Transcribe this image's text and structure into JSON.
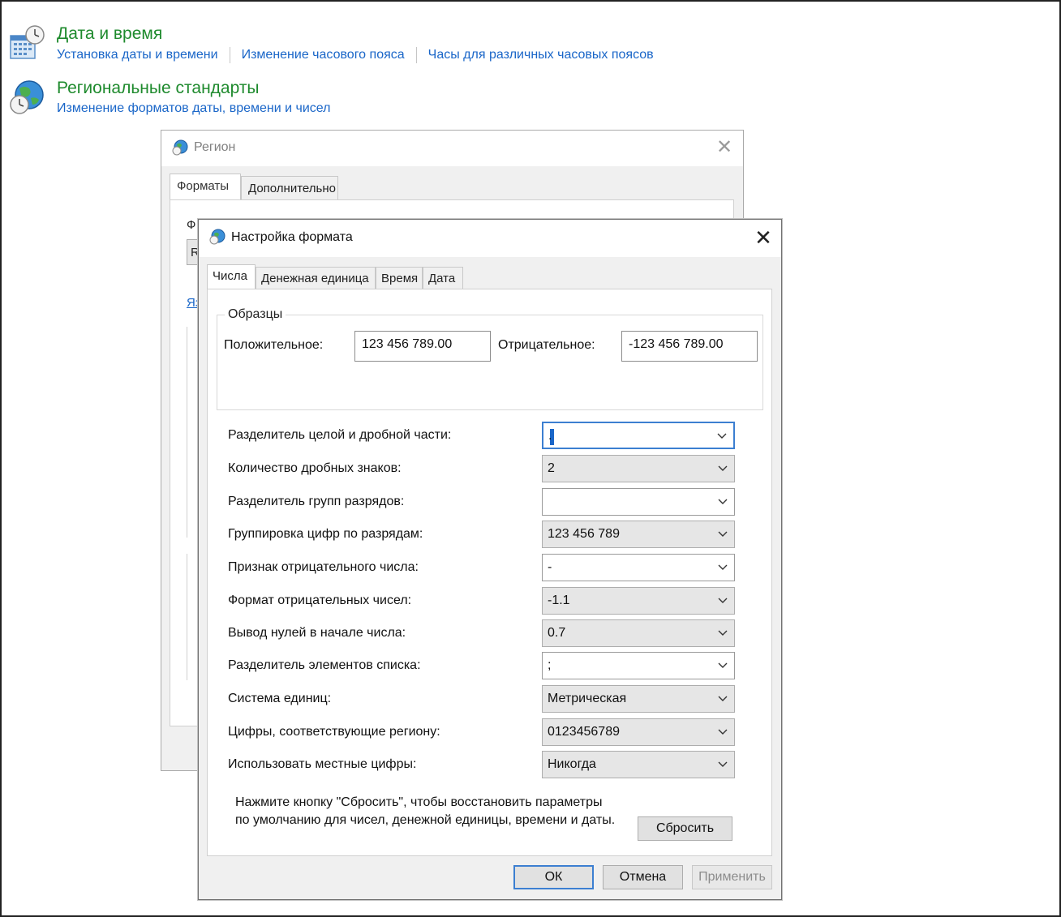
{
  "control_panel": {
    "datetime": {
      "title": "Дата и время",
      "links": [
        "Установка даты и времени",
        "Изменение часового пояса",
        "Часы для различных часовых поясов"
      ],
      "icon": "calendar-clock-icon"
    },
    "regional": {
      "title": "Региональные стандарты",
      "links": [
        "Изменение форматов даты, времени и чисел"
      ],
      "icon": "globe-clock-icon"
    },
    "link_color": "#1a66c8",
    "title_color": "#1e8a2d"
  },
  "region_window": {
    "title": "Регион",
    "tabs": [
      "Форматы",
      "Дополнительно"
    ],
    "active_tab": "Форматы",
    "fragments": [
      "Ф",
      "R",
      "Яз"
    ]
  },
  "format_dialog": {
    "title": "Настройка формата",
    "tabs": [
      "Числа",
      "Денежная единица",
      "Время",
      "Дата"
    ],
    "active_tab": "Числа",
    "samples": {
      "legend": "Образцы",
      "positive_label": "Положительное:",
      "positive_value": "123 456 789.00",
      "negative_label": "Отрицательное:",
      "negative_value": "-123 456 789.00"
    },
    "settings": [
      {
        "label": "Разделитель целой и дробной части:",
        "value": ".",
        "style": "focus"
      },
      {
        "label": "Количество дробных знаков:",
        "value": "2",
        "style": "list"
      },
      {
        "label": "Разделитель групп разрядов:",
        "value": "",
        "style": "edit"
      },
      {
        "label": "Группировка цифр по разрядам:",
        "value": "123 456 789",
        "style": "list"
      },
      {
        "label": "Признак отрицательного числа:",
        "value": "-",
        "style": "edit"
      },
      {
        "label": "Формат отрицательных чисел:",
        "value": "-1.1",
        "style": "list"
      },
      {
        "label": "Вывод нулей в начале числа:",
        "value": "0.7",
        "style": "list"
      },
      {
        "label": "Разделитель элементов списка:",
        "value": ";",
        "style": "edit"
      },
      {
        "label": "Система единиц:",
        "value": "Метрическая",
        "style": "list"
      },
      {
        "label": "Цифры, соответствующие региону:",
        "value": "0123456789",
        "style": "list"
      },
      {
        "label": "Использовать местные цифры:",
        "value": "Никогда",
        "style": "list"
      }
    ],
    "reset_note": "Нажмите кнопку \"Сбросить\", чтобы восстановить параметры по умолчанию для чисел, денежной единицы, времени и даты.",
    "buttons": {
      "reset": "Сбросить",
      "ok": "ОК",
      "cancel": "Отмена",
      "apply": "Применить"
    },
    "accent": "#3c7fd1"
  }
}
